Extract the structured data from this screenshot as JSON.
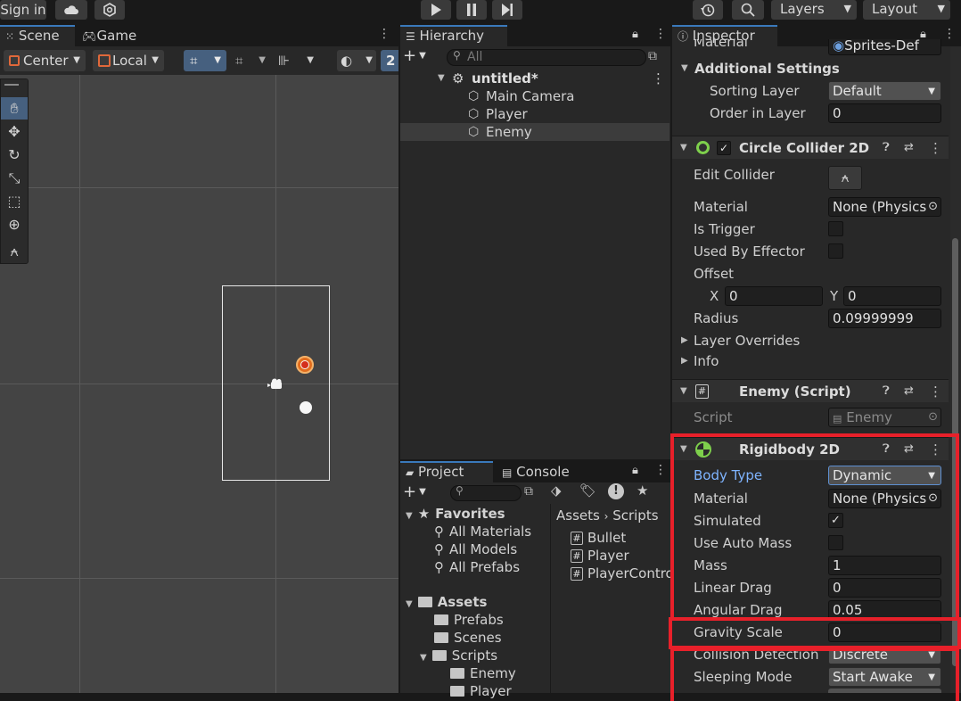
{
  "toolbar": {
    "sign_in": "Sign in",
    "layers": "Layers",
    "layout": "Layout"
  },
  "scene": {
    "tabs": [
      "Scene",
      "Game"
    ],
    "pivot": "Center",
    "space": "Local",
    "number_btn": "2"
  },
  "hierarchy": {
    "tab": "Hierarchy",
    "search_placeholder": "All",
    "scene_name": "untitled*",
    "items": [
      "Main Camera",
      "Player",
      "Enemy"
    ]
  },
  "project": {
    "tabs": [
      "Project",
      "Console"
    ],
    "favorites_label": "Favorites",
    "favorites": [
      "All Materials",
      "All Models",
      "All Prefabs"
    ],
    "assets_label": "Assets",
    "folders": [
      "Prefabs",
      "Scenes",
      "Scripts",
      "Enemy",
      "Player"
    ],
    "breadcrumb": [
      "Assets",
      "Scripts"
    ],
    "files": [
      "Bullet",
      "Player",
      "PlayerContro"
    ]
  },
  "inspector": {
    "tab": "Inspector",
    "material_top_label": "Material",
    "material_top_value": "Sprites-Def",
    "additional_settings": "Additional Settings",
    "sorting_layer_label": "Sorting Layer",
    "sorting_layer_value": "Default",
    "order_label": "Order in Layer",
    "order_value": "0",
    "circle_collider": {
      "title": "Circle Collider 2D",
      "edit_collider": "Edit Collider",
      "material_label": "Material",
      "material_value": "None (Physics",
      "is_trigger": "Is Trigger",
      "used_by_effector": "Used By Effector",
      "offset": "Offset",
      "x_label": "X",
      "x_value": "0",
      "y_label": "Y",
      "y_value": "0",
      "radius_label": "Radius",
      "radius_value": "0.09999999",
      "layer_overrides": "Layer Overrides",
      "info": "Info"
    },
    "enemy_script": {
      "title": "Enemy (Script)",
      "script_label": "Script",
      "script_value": "Enemy"
    },
    "rigidbody": {
      "title": "Rigidbody 2D",
      "body_type_label": "Body Type",
      "body_type_value": "Dynamic",
      "material_label": "Material",
      "material_value": "None (Physics",
      "simulated_label": "Simulated",
      "use_auto_mass_label": "Use Auto Mass",
      "mass_label": "Mass",
      "mass_value": "1",
      "linear_drag_label": "Linear Drag",
      "linear_drag_value": "0",
      "angular_drag_label": "Angular Drag",
      "angular_drag_value": "0.05",
      "gravity_scale_label": "Gravity Scale",
      "gravity_scale_value": "0",
      "collision_detection_label": "Collision Detection",
      "collision_detection_value": "Discrete",
      "sleeping_mode_label": "Sleeping Mode",
      "sleeping_mode_value": "Start Awake"
    }
  },
  "colors": {
    "accent": "#3a79bb",
    "highlight": "#e8202a",
    "body_type_label": "#7fb4ff"
  }
}
